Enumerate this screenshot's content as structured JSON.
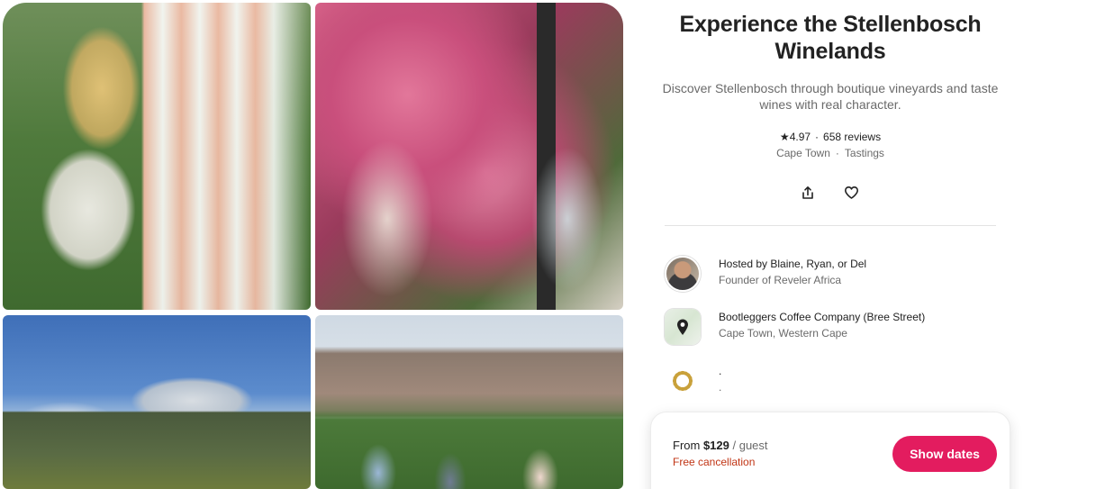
{
  "experience": {
    "title": "Experience the Stellenbosch Winelands",
    "description": "Discover Stellenbosch through boutique vineyards and taste wines with real character.",
    "rating": "4.97",
    "rating_star": "★",
    "separator": "·",
    "reviews": "658 reviews",
    "location": "Cape Town",
    "category": "Tastings"
  },
  "gallery": {
    "photos": [
      {
        "name": "photo-couple-wine-pour"
      },
      {
        "name": "photo-women-drinking-wine"
      },
      {
        "name": "photo-mountain-sky"
      },
      {
        "name": "photo-group-tour-mountains"
      }
    ]
  },
  "actions": {
    "share_icon": "share-icon",
    "save_icon": "heart-icon"
  },
  "details": [
    {
      "title": "Hosted by Blaine, Ryan, or Del",
      "subtitle": "Founder of Reveler Africa",
      "icon": "host-avatar"
    },
    {
      "title": "Bootleggers Coffee Company (Bree Street)",
      "subtitle": "Cape Town, Western Cape",
      "icon": "map-pin-icon"
    },
    {
      "title": ".",
      "subtitle": ".",
      "icon": "badge-icon"
    }
  ],
  "booking": {
    "price_prefix": "From ",
    "price": "$129",
    "price_unit": " / guest",
    "cancellation": "Free cancellation",
    "cta_label": "Show dates"
  },
  "colors": {
    "accent": "#e31c5f",
    "cancellation": "#c13515",
    "text_primary": "#222222",
    "text_secondary": "#6a6a6a"
  }
}
